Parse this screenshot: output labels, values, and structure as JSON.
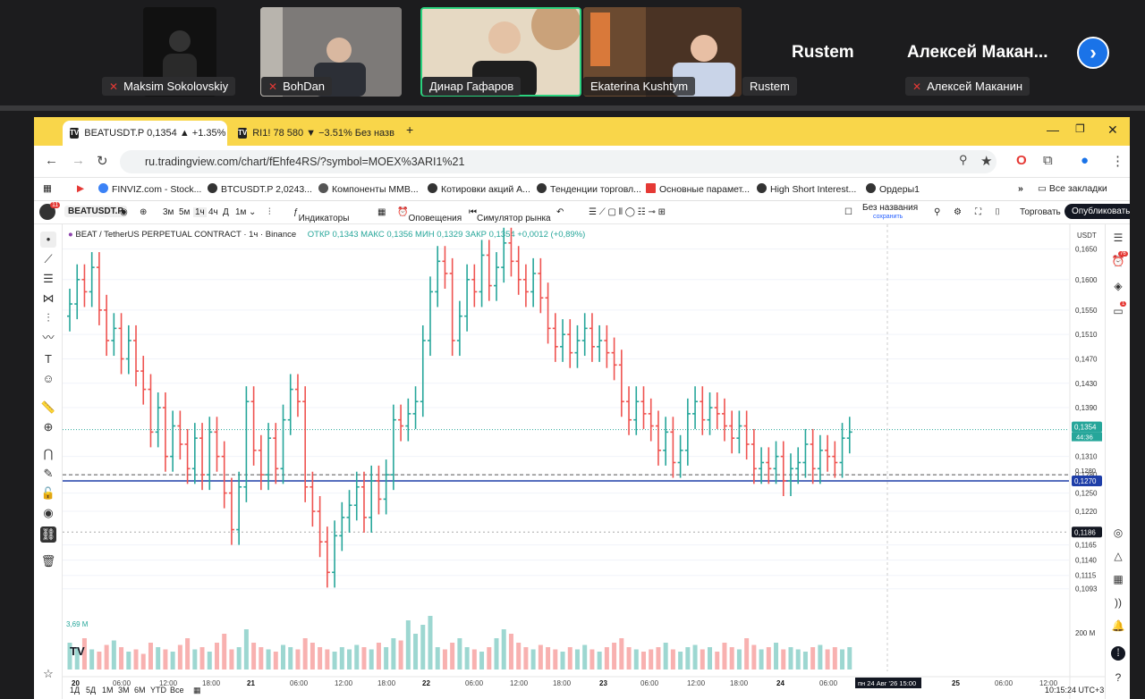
{
  "conference": {
    "participants": [
      {
        "name": "Maksim Sokolovskiy",
        "muted": true
      },
      {
        "name": "BohDan",
        "muted": true
      },
      {
        "name": "Динар Гафаров",
        "muted": false
      },
      {
        "name": "Ekaterina Kushtym",
        "muted": false
      },
      {
        "name": "Rustem",
        "muted": false
      },
      {
        "name": "Алексей Маканин",
        "muted": true
      }
    ],
    "big_names": [
      "Rustem",
      "Алексей  Макан..."
    ],
    "next_icon": "chevron-right-icon"
  },
  "browser": {
    "tabs": [
      {
        "label": "BEATUSDT.P 0,1354 ▲ +1.35% |",
        "active": true
      },
      {
        "label": "RI1! 78 580 ▼ −3.51% Без назв",
        "active": false
      }
    ],
    "url": "ru.tradingview.com/chart/fEhfe4RS/?symbol=MOEX%3ARI1%21",
    "bookmarks": [
      "FINVIZ.com - Stock...",
      "BTCUSDT.P 2,0243...",
      "Компоненты MMB...",
      "Котировки акций А...",
      "Тенденции торговл...",
      "Основные парамет...",
      "High Short Interest...",
      "Ордеры1"
    ],
    "all_bookmarks": "Все закладки"
  },
  "tv": {
    "symbol": "BEATUSDT.P",
    "intervals": [
      "3м",
      "5м",
      "1ч",
      "4ч",
      "Д",
      "1м"
    ],
    "indicators": "Индикаторы",
    "alerts": "Оповещения",
    "replay": "Симулятор рынка",
    "layout_name": "Без названия",
    "layout_saved": "сохранить",
    "trade": "Торговать",
    "publish": "Опубликовать",
    "notif_badge": "11",
    "legend_title": "BEAT / TetherUS PERPETUAL CONTRACT · 1ч · Binance",
    "legend_values": "ОТКР 0,1343  МАКС 0,1356  МИН 0,1329  ЗАКР 0,1354  +0,0012 (+0,89%)",
    "currency": "USDT",
    "price_current": "0,1354",
    "price_countdown": "44:36",
    "price_line": "0,1270",
    "price_hline": "0,1186",
    "price_dash": "0,1280",
    "volume_label": "3,69 M",
    "volume_axis": "200 M",
    "x_labels": [
      "20",
      "06:00",
      "12:00",
      "18:00",
      "21",
      "06:00",
      "12:00",
      "18:00",
      "22",
      "06:00",
      "12:00",
      "18:00",
      "23",
      "06:00",
      "12:00",
      "18:00",
      "24",
      "06:00",
      "25",
      "06:00",
      "12:00"
    ],
    "crosshair_date": "пн 24 Авг '26  15:00",
    "ranges": [
      "1Д",
      "5Д",
      "1М",
      "3М",
      "6М",
      "YTD",
      "Все"
    ],
    "clock": "10:15:24 UTC+3",
    "right_badges": [
      "76",
      "1"
    ]
  },
  "chart_data": {
    "type": "ohlc",
    "title": "BEAT / TetherUS PERPETUAL CONTRACT · 1ч · Binance",
    "y_ticks": [
      "0,1650",
      "0,1600",
      "0,1550",
      "0,1510",
      "0,1470",
      "0,1430",
      "0,1390",
      "0,1310",
      "0,1280",
      "0,1250",
      "0,1220",
      "0,1165",
      "0,1140",
      "0,1115",
      "0,1093"
    ],
    "ylim": [
      0.1075,
      0.167
    ],
    "colors": {
      "up": "#26a69a",
      "down": "#ef5350"
    },
    "series": [
      {
        "name": "BEAT",
        "values": [
          0.156,
          0.16,
          0.158,
          0.162,
          0.155,
          0.15,
          0.152,
          0.147,
          0.15,
          0.145,
          0.142,
          0.135,
          0.139,
          0.131,
          0.136,
          0.133,
          0.129,
          0.134,
          0.128,
          0.135,
          0.131,
          0.125,
          0.119,
          0.126,
          0.14,
          0.132,
          0.128,
          0.134,
          0.129,
          0.137,
          0.142,
          0.14,
          0.126,
          0.122,
          0.117,
          0.112,
          0.118,
          0.121,
          0.123,
          0.126,
          0.121,
          0.127,
          0.124,
          0.128,
          0.137,
          0.136,
          0.138,
          0.14,
          0.15,
          0.158,
          0.163,
          0.161,
          0.15,
          0.154,
          0.16,
          0.158,
          0.164,
          0.159,
          0.162,
          0.166,
          0.163,
          0.16,
          0.158,
          0.161,
          0.157,
          0.152,
          0.149,
          0.151,
          0.148,
          0.15,
          0.152,
          0.149,
          0.15,
          0.148,
          0.146,
          0.14,
          0.137,
          0.14,
          0.138,
          0.136,
          0.132,
          0.135,
          0.13,
          0.132,
          0.138,
          0.14,
          0.137,
          0.139,
          0.138,
          0.136,
          0.134,
          0.136,
          0.133,
          0.129,
          0.13,
          0.129,
          0.131,
          0.127,
          0.129,
          0.13,
          0.133,
          0.129,
          0.132,
          0.131,
          0.13,
          0.134,
          0.135
        ]
      }
    ],
    "volume": [
      12,
      10,
      14,
      9,
      8,
      11,
      13,
      10,
      8,
      9,
      7,
      12,
      10,
      9,
      8,
      11,
      14,
      9,
      10,
      8,
      12,
      16,
      9,
      10,
      18,
      12,
      10,
      9,
      8,
      11,
      10,
      9,
      14,
      12,
      10,
      9,
      8,
      10,
      9,
      11,
      10,
      9,
      12,
      10,
      14,
      13,
      22,
      16,
      20,
      24,
      10,
      9,
      12,
      14,
      10,
      9,
      8,
      10,
      14,
      18,
      16,
      12,
      10,
      9,
      11,
      10,
      9,
      8,
      10,
      9,
      11,
      9,
      8,
      10,
      12,
      14,
      10,
      9,
      8,
      9,
      10,
      12,
      9,
      8,
      10,
      11,
      9,
      10,
      8,
      12,
      10,
      9,
      14,
      11,
      9,
      10,
      12,
      9,
      10,
      9,
      8,
      10,
      11,
      9,
      10,
      9,
      10
    ]
  }
}
